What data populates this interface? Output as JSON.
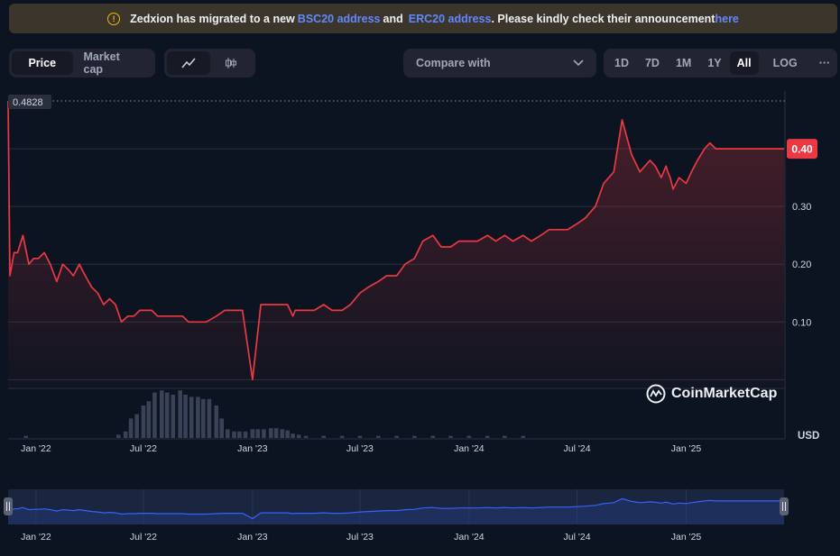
{
  "banner": {
    "pre": "Zedxion has migrated to a new",
    "link1": "BSC20 address",
    "mid": "and",
    "link2": "ERC20 address",
    "post": ". Please kindly check their announcement",
    "link3": "here",
    "accent": "#f0b90b",
    "link_color": "#6188ff"
  },
  "tabs": {
    "price": "Price",
    "market_cap": "Market cap",
    "active": "Price"
  },
  "chart_modes": [
    {
      "name": "line-chart-icon",
      "active": true
    },
    {
      "name": "candlestick-icon",
      "active": false
    }
  ],
  "compare": {
    "label": "Compare with"
  },
  "ranges": [
    "1D",
    "7D",
    "1M",
    "1Y",
    "All"
  ],
  "active_range": "All",
  "log_label": "LOG",
  "more_label": "···",
  "currency": "USD",
  "watermark": "CoinMarketCap",
  "colors": {
    "line": "#ea3943",
    "nav_line": "#3861fb",
    "background": "#0d1421"
  },
  "chart_data": {
    "type": "line",
    "title": "",
    "ylabel": "",
    "xlabel": "",
    "y_ticks": [
      0.1,
      0.2,
      0.3
    ],
    "y_tick_labels": [
      "0.10",
      "0.20",
      "0.30"
    ],
    "ylim": [
      -0.012,
      0.5
    ],
    "x_tick_labels": [
      "Jan '22",
      "Jul '22",
      "Jan '23",
      "Jul '23",
      "Jan '24",
      "Jul '24",
      "Jan '25"
    ],
    "x_tick_dates": [
      "2022-01-01",
      "2022-07-01",
      "2023-01-01",
      "2023-07-01",
      "2024-01-01",
      "2024-07-01",
      "2025-01-01"
    ],
    "high_label": "0.4828",
    "high_value": 0.4828,
    "last_label": "0.40",
    "last_value": 0.4,
    "grid": true,
    "series": [
      {
        "x": [
          "2021-11-15",
          "2021-11-18",
          "2021-11-25",
          "2021-12-01",
          "2021-12-10",
          "2021-12-20",
          "2021-12-28",
          "2022-01-05",
          "2022-01-15",
          "2022-01-25",
          "2022-02-05",
          "2022-02-15",
          "2022-02-25",
          "2022-03-05",
          "2022-03-15",
          "2022-03-25",
          "2022-04-05",
          "2022-04-15",
          "2022-04-25",
          "2022-05-05",
          "2022-05-15",
          "2022-05-25",
          "2022-06-05",
          "2022-06-15",
          "2022-06-25",
          "2022-07-01",
          "2022-07-08",
          "2022-07-15",
          "2022-07-25",
          "2022-08-05",
          "2022-08-15",
          "2022-08-25",
          "2022-09-05",
          "2022-09-15",
          "2022-10-01",
          "2022-10-15",
          "2022-11-01",
          "2022-11-15",
          "2022-12-01",
          "2022-12-15",
          "2023-01-01",
          "2023-01-15",
          "2023-02-01",
          "2023-02-15",
          "2023-03-01",
          "2023-03-10",
          "2023-03-14",
          "2023-03-17",
          "2023-03-20",
          "2023-04-01",
          "2023-04-15",
          "2023-05-01",
          "2023-05-15",
          "2023-06-01",
          "2023-06-15",
          "2023-07-01",
          "2023-07-15",
          "2023-08-01",
          "2023-08-15",
          "2023-09-01",
          "2023-09-15",
          "2023-10-01",
          "2023-10-15",
          "2023-11-01",
          "2023-11-15",
          "2023-12-01",
          "2023-12-15",
          "2024-01-01",
          "2024-01-15",
          "2024-02-01",
          "2024-02-15",
          "2024-03-01",
          "2024-03-15",
          "2024-04-01",
          "2024-04-15",
          "2024-05-01",
          "2024-05-15",
          "2024-06-01",
          "2024-06-15",
          "2024-07-01",
          "2024-07-15",
          "2024-08-01",
          "2024-08-15",
          "2024-09-01",
          "2024-09-15",
          "2024-10-01",
          "2024-10-15",
          "2024-11-01",
          "2024-11-10",
          "2024-11-20",
          "2024-11-28",
          "2024-12-01",
          "2024-12-05",
          "2024-12-10",
          "2024-12-20",
          "2025-01-01",
          "2025-01-10",
          "2025-01-20",
          "2025-02-01",
          "2025-02-10",
          "2025-02-20",
          "2025-03-01",
          "2025-03-15",
          "2025-04-01",
          "2025-04-15",
          "2025-05-01",
          "2025-05-15",
          "2025-05-25",
          "2025-06-05",
          "2025-06-15"
        ],
        "y": [
          0.4828,
          0.18,
          0.22,
          0.22,
          0.25,
          0.2,
          0.21,
          0.21,
          0.22,
          0.2,
          0.17,
          0.2,
          0.19,
          0.18,
          0.2,
          0.18,
          0.16,
          0.15,
          0.13,
          0.14,
          0.13,
          0.1,
          0.11,
          0.11,
          0.12,
          0.12,
          0.12,
          0.12,
          0.11,
          0.11,
          0.11,
          0.11,
          0.11,
          0.1,
          0.1,
          0.1,
          0.11,
          0.12,
          0.12,
          0.12,
          0.0,
          0.13,
          0.13,
          0.13,
          0.13,
          0.11,
          0.12,
          0.12,
          0.12,
          0.12,
          0.12,
          0.13,
          0.12,
          0.12,
          0.13,
          0.15,
          0.16,
          0.17,
          0.18,
          0.18,
          0.2,
          0.21,
          0.24,
          0.25,
          0.23,
          0.23,
          0.24,
          0.24,
          0.24,
          0.25,
          0.24,
          0.25,
          0.24,
          0.25,
          0.24,
          0.25,
          0.26,
          0.26,
          0.26,
          0.27,
          0.28,
          0.3,
          0.34,
          0.36,
          0.45,
          0.39,
          0.36,
          0.38,
          0.37,
          0.35,
          0.37,
          0.36,
          0.35,
          0.33,
          0.35,
          0.34,
          0.36,
          0.38,
          0.4,
          0.41,
          0.4,
          0.4,
          0.4,
          0.4,
          0.4,
          0.4,
          0.4,
          0.4,
          0.4,
          0.4
        ]
      }
    ],
    "volume": {
      "x": [
        "2021-12-15",
        "2022-05-20",
        "2022-06-01",
        "2022-06-10",
        "2022-06-20",
        "2022-07-01",
        "2022-07-10",
        "2022-07-20",
        "2022-08-01",
        "2022-08-10",
        "2022-08-20",
        "2022-09-01",
        "2022-09-10",
        "2022-09-20",
        "2022-10-01",
        "2022-10-10",
        "2022-10-20",
        "2022-11-01",
        "2022-11-10",
        "2022-11-20",
        "2022-12-01",
        "2022-12-10",
        "2022-12-20",
        "2023-01-01",
        "2023-01-10",
        "2023-01-20",
        "2023-02-01",
        "2023-02-10",
        "2023-02-20",
        "2023-03-01",
        "2023-03-10",
        "2023-03-20",
        "2023-04-01",
        "2023-05-01",
        "2023-06-01",
        "2023-07-01",
        "2023-08-01",
        "2023-09-01",
        "2023-10-01",
        "2023-11-01",
        "2023-12-01",
        "2024-01-01",
        "2024-02-01",
        "2024-03-01",
        "2024-04-01"
      ],
      "y": [
        2,
        3,
        6,
        18,
        22,
        30,
        34,
        42,
        44,
        42,
        40,
        44,
        40,
        38,
        38,
        36,
        36,
        30,
        18,
        8,
        6,
        6,
        6,
        8,
        8,
        8,
        9,
        9,
        8,
        7,
        4,
        3,
        2,
        2,
        2,
        2,
        2,
        2,
        2,
        2,
        2,
        2,
        2,
        2,
        2
      ]
    },
    "navigator": {
      "x_tick_labels": [
        "Jan '22",
        "Jul '22",
        "Jan '23",
        "Jul '23",
        "Jan '24",
        "Jul '24",
        "Jan '25"
      ]
    }
  }
}
